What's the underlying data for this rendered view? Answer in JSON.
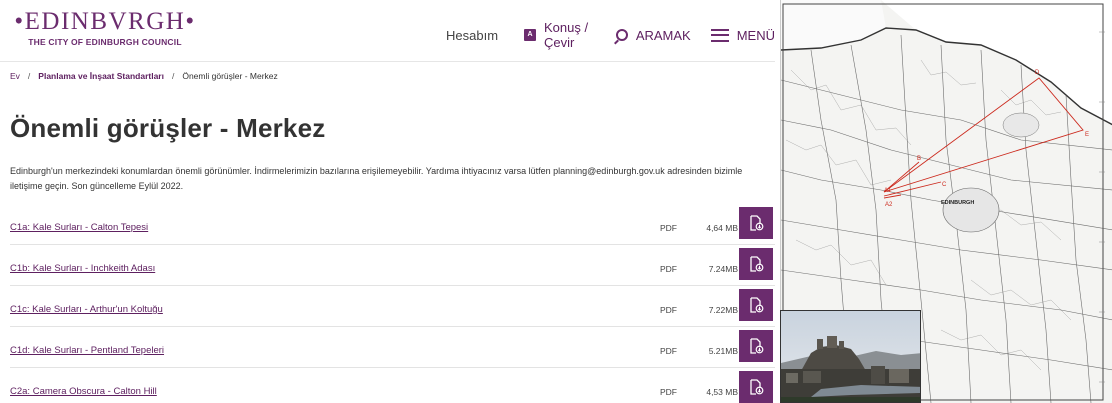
{
  "header": {
    "logo_main": "•EDINBVRGH•",
    "logo_sub": "THE CITY OF EDINBURGH COUNCIL",
    "nav": {
      "account": "Hesabım",
      "translate": "Konuş / Çevir",
      "search": "ARAMAK",
      "menu": "MENÜ"
    }
  },
  "breadcrumb": {
    "home": "Ev",
    "section": "Planlama ve İnşaat Standartları",
    "current": "Önemli görüşler - Merkez",
    "separator": "/"
  },
  "page": {
    "title": "Önemli görüşler - Merkez",
    "intro": "Edinburgh'un merkezindeki konumlardan önemli görünümler. İndirmelerimizin bazılarına erişilemeyebilir. Yardıma ihtiyacınız varsa lütfen planning@edinburgh.gov.uk adresinden bizimle iletişime geçin. Son güncelleme Eylül 2022."
  },
  "documents": [
    {
      "title": "C1a: Kale Surları - Calton Tepesi",
      "type": "PDF",
      "size": "4,64 MB"
    },
    {
      "title": "C1b: Kale Surları - Inchkeith Adası",
      "type": "PDF",
      "size": "7.24MB"
    },
    {
      "title": "C1c: Kale Surları - Arthur'un Koltuğu",
      "type": "PDF",
      "size": "7.22MB"
    },
    {
      "title": "C1d: Kale Surları - Pentland Tepeleri",
      "type": "PDF",
      "size": "5.21MB"
    },
    {
      "title": "C2a: Camera Obscura - Calton Hill",
      "type": "PDF",
      "size": "4,53 MB"
    }
  ],
  "map": {
    "labels": {
      "city": "EDINBURGH",
      "a1": "A1",
      "a2": "A2",
      "b": "B",
      "c": "C",
      "d": "D",
      "e": "E"
    },
    "line_color": "#cc2a1e"
  },
  "colors": {
    "brand": "#6b2c6e",
    "link": "#5e2060"
  }
}
